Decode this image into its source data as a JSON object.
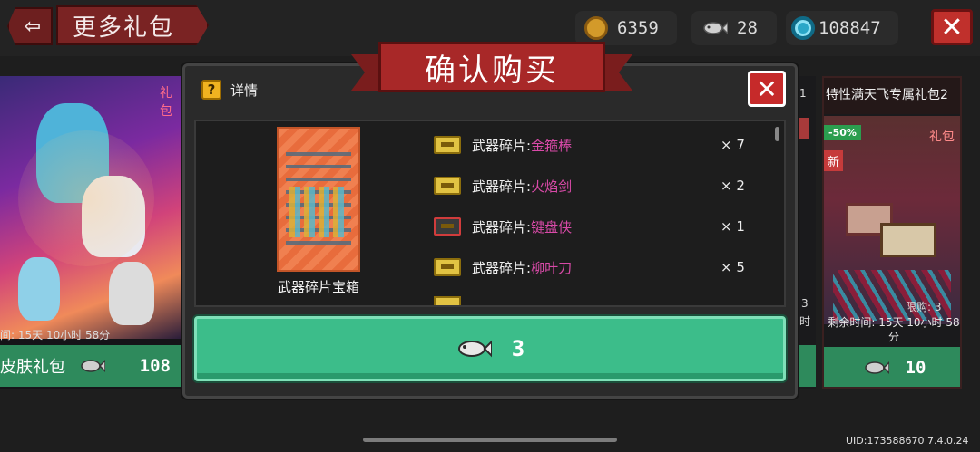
{
  "header": {
    "back_icon": "exit-arrow-icon",
    "title": "更多礼包",
    "currencies": [
      {
        "icon": "gold-coin-icon",
        "value": "6359"
      },
      {
        "icon": "fish-icon",
        "value": "28"
      },
      {
        "icon": "blue-gem-icon",
        "value": "108847"
      }
    ],
    "close_icon": "close-x-icon"
  },
  "background_cards": {
    "left": {
      "tag": "礼包",
      "timer": "间: 15天 10小时 58分",
      "name": "皮肤礼包",
      "price": "108"
    },
    "right": {
      "title": "特性满天飞专属礼包2",
      "sale_badge": "-50%",
      "new_badge": "新",
      "gift_tag": "礼包",
      "limit": "限购: 3",
      "timer": "剩余时间: 15天 10小时 58分",
      "price": "10"
    },
    "peek_texts": [
      "1",
      "3",
      "时"
    ]
  },
  "modal": {
    "title": "确认购买",
    "detail_label": "详情",
    "chest_name": "武器碎片宝箱",
    "items": [
      {
        "prefix": "武器碎片: ",
        "name": "金箍棒",
        "qty": "× 7"
      },
      {
        "prefix": "武器碎片: ",
        "name": "火焰剑",
        "qty": "× 2"
      },
      {
        "prefix": "武器碎片: ",
        "name": "键盘侠",
        "qty": "× 1"
      },
      {
        "prefix": "武器碎片: ",
        "name": "柳叶刀",
        "qty": "× 5"
      }
    ],
    "buy_price": "3",
    "colors": {
      "weapon_name": "#d94aa8",
      "buy_button": "#3cbd8a"
    }
  },
  "footer": {
    "uid": "UID:173588670 7.4.0.24"
  }
}
